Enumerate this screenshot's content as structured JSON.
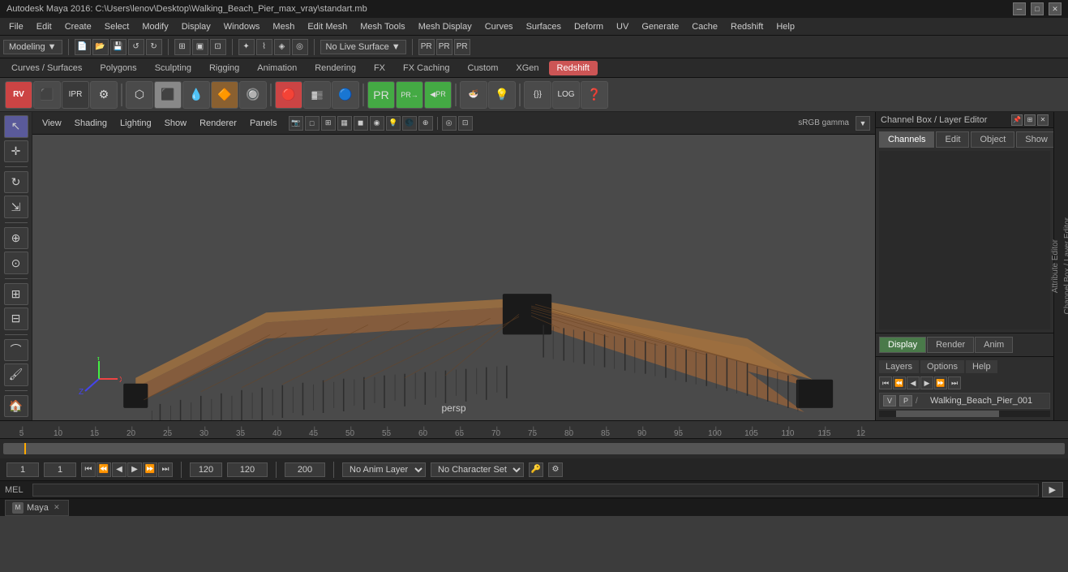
{
  "titleBar": {
    "title": "Autodesk Maya 2016: C:\\Users\\lenov\\Desktop\\Walking_Beach_Pier_max_vray\\standart.mb",
    "minimizeIcon": "─",
    "maximizeIcon": "□",
    "closeIcon": "✕"
  },
  "menuBar": {
    "items": [
      "File",
      "Edit",
      "Create",
      "Select",
      "Modify",
      "Display",
      "Windows",
      "Mesh",
      "Edit Mesh",
      "Mesh Tools",
      "Mesh Display",
      "Curves",
      "Surfaces",
      "Deform",
      "UV",
      "Generate",
      "Cache",
      "Redshift",
      "Help"
    ]
  },
  "workflowBar": {
    "moduleDropdown": "Modeling",
    "noLiveLabel": "No Live Surface"
  },
  "moduleBar": {
    "items": [
      "Curves / Surfaces",
      "Polygons",
      "Sculpting",
      "Rigging",
      "Animation",
      "Rendering",
      "FX",
      "FX Caching",
      "Custom",
      "XGen"
    ],
    "activeItem": "Redshift"
  },
  "shelfBar": {
    "icons": [
      "🎯",
      "📦",
      "💡",
      "🔮",
      "🍩",
      "🔶",
      "🔵",
      "✏️",
      "⚙️",
      "🔩",
      "📐",
      "🔁",
      "🎨",
      "📷",
      "🖥",
      "❓"
    ]
  },
  "viewport": {
    "menuItems": [
      "View",
      "Shading",
      "Lighting",
      "Show",
      "Renderer",
      "Panels"
    ],
    "perspLabel": "persp",
    "colorspaceLabel": "sRGB gamma"
  },
  "channelBox": {
    "title": "Channel Box / Layer Editor",
    "panelTabs": [
      "Channels",
      "Edit",
      "Object",
      "Show"
    ],
    "displayTabs": [
      {
        "label": "Display",
        "active": true
      },
      {
        "label": "Render",
        "active": false
      },
      {
        "label": "Anim",
        "active": false
      }
    ],
    "layerTabs": [
      "Layers",
      "Options",
      "Help"
    ],
    "layerNavBtns": [
      "⏮",
      "⏪",
      "◀",
      "▶",
      "⏩",
      "⏭"
    ],
    "layers": [
      {
        "v": "V",
        "p": "P",
        "name": "Walking_Beach_Pier_001"
      }
    ]
  },
  "rightStrip": {
    "labels": [
      "Channel Box / Layer Editor",
      "Attribute Editor"
    ]
  },
  "timeline": {
    "ticks": [
      "5",
      "10",
      "15",
      "20",
      "25",
      "30",
      "35",
      "40",
      "45",
      "50",
      "55",
      "60",
      "65",
      "70",
      "75",
      "80",
      "85",
      "90",
      "95",
      "100",
      "105",
      "110",
      "115",
      "12"
    ],
    "startFrame": "1",
    "endFrame": "120",
    "currentFrame": "1",
    "rangeStart": "1",
    "rangeEnd": "120"
  },
  "playbackControls": {
    "currentFrame": "1",
    "startFrame": "1",
    "frameInput": "1",
    "endFrame": "120",
    "altEnd": "120",
    "altEnd2": "200",
    "buttons": [
      "⏮",
      "⏪",
      "⏴",
      "▶",
      "⏩",
      "⏭"
    ],
    "animLayer": "No Anim Layer",
    "charSet": "No Character Set",
    "fps": "1"
  },
  "commandLine": {
    "label": "MEL",
    "inputPlaceholder": ""
  },
  "taskbar": {
    "items": [
      {
        "icon": "🖥",
        "label": "Maya",
        "closable": false
      }
    ]
  },
  "axis": {
    "x": "X",
    "y": "Y",
    "z": "Z"
  }
}
